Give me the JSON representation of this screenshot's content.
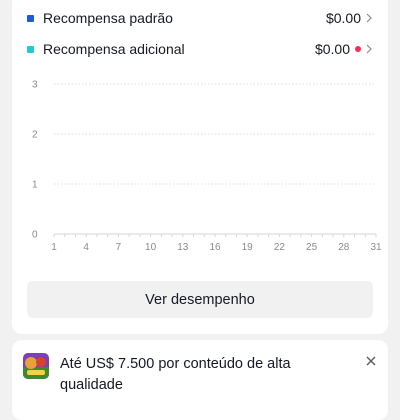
{
  "rewards": {
    "items": [
      {
        "label": "Recompensa padrão",
        "value": "$0.00",
        "color": "#1e5bd6",
        "has_alert": false
      },
      {
        "label": "Recompensa adicional",
        "value": "$0.00",
        "color": "#25c9d6",
        "has_alert": true
      }
    ]
  },
  "chart_data": {
    "type": "line",
    "x": [
      1,
      4,
      7,
      10,
      13,
      16,
      19,
      22,
      25,
      28,
      31
    ],
    "xticks": [
      "1",
      "4",
      "7",
      "10",
      "13",
      "16",
      "19",
      "22",
      "25",
      "28",
      "31"
    ],
    "yticks": [
      "0",
      "1",
      "2",
      "3"
    ],
    "ylim": [
      0,
      3
    ],
    "xlim": [
      1,
      31
    ],
    "series": [
      {
        "color": "#1e5bd6",
        "values": []
      },
      {
        "color": "#25c9d6",
        "values": []
      }
    ],
    "grid": true
  },
  "actions": {
    "view_performance": "Ver desempenho"
  },
  "promo": {
    "text": "Até US$ 7.500 por conteúdo de alta qualidade",
    "icon": "game-app-icon",
    "close_icon": "close-icon"
  },
  "colors": {
    "alert": "#fe2c55",
    "text": "#161823",
    "muted": "#8a8b91"
  }
}
